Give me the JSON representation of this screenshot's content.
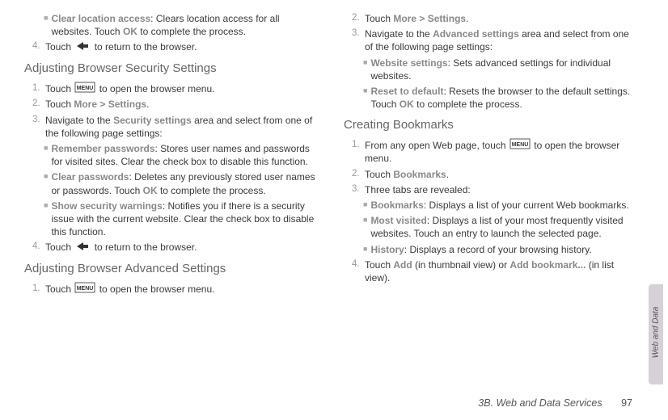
{
  "left": {
    "bullet0": {
      "label": "Clear location access",
      "desc": ": Clears location access for all websites. Touch ",
      "ok": "OK",
      "desc2": " to complete the process."
    },
    "step4_prefix": "4.",
    "step4_a": "Touch ",
    "step4_b": " to return to the browser.",
    "heading1": "Adjusting Browser Security Settings",
    "s1": {
      "num": "1.",
      "a": "Touch ",
      "b": " to open the browser menu."
    },
    "s2": {
      "num": "2.",
      "a": "Touch ",
      "more": "More",
      "gt": ">",
      "settings": "Settings",
      "dot": "."
    },
    "s3": {
      "num": "3.",
      "a": "Navigate to the ",
      "title": "Security settings",
      "b": " area and select from one of the following page settings:"
    },
    "s3b1": {
      "label": "Remember passwords",
      "desc": ": Stores user names and passwords for visited sites. Clear the check box to disable this function."
    },
    "s3b2": {
      "label": "Clear passwords",
      "desc": ": Deletes any previously stored user names or passwords. Touch ",
      "ok": "OK",
      "desc2": " to complete the process."
    },
    "s3b3": {
      "label": "Show security warnings",
      "desc": ": Notifies you if there is a security issue with the current website. Clear the check box to disable this function."
    },
    "s4": {
      "num": "4.",
      "a": "Touch ",
      "b": " to return to the browser."
    },
    "heading2": "Adjusting Browser Advanced Settings",
    "s5": {
      "num": "1.",
      "a": "Touch ",
      "b": " to open the browser menu."
    }
  },
  "right": {
    "s2": {
      "num": "2.",
      "a": "Touch ",
      "more": "More",
      "gt": ">",
      "settings": "Settings",
      "dot": "."
    },
    "s3": {
      "num": "3.",
      "a": "Navigate to the ",
      "title": "Advanced settings",
      "b": " area and select from one of the following page settings:"
    },
    "s3b1": {
      "label": "Website settings",
      "desc": ": Sets advanced settings for individual websites."
    },
    "s3b2": {
      "label": "Reset to default",
      "desc": ": Resets the browser to the default settings. Touch ",
      "ok": "OK",
      "desc2": " to complete the process."
    },
    "heading1": "Creating Bookmarks",
    "s1": {
      "num": "1.",
      "a": "From any open Web page, touch ",
      "b": " to open the browser menu."
    },
    "s2b": {
      "num": "2.",
      "a": "Touch ",
      "bm": "Bookmarks",
      "dot": "."
    },
    "s3b": {
      "num": "3.",
      "a": "Three tabs are revealed:"
    },
    "s3bb1": {
      "label": "Bookmarks",
      "desc": ": Displays a list of your current Web bookmarks."
    },
    "s3bb2": {
      "label": "Most visited",
      "desc": ": Displays a list of your most frequently visited websites. Touch an entry to launch the selected page."
    },
    "s3bb3": {
      "label": "History",
      "desc": ": Displays a record of your browsing history."
    },
    "s4": {
      "num": "4.",
      "a": "Touch ",
      "add": "Add",
      "mid": " (in thumbnail view) or ",
      "addbm": "Add bookmark...",
      "end": " (in list view)."
    }
  },
  "footer": {
    "section": "3B. Web and Data Services",
    "page": "97"
  },
  "sidetab": "Web and Data"
}
